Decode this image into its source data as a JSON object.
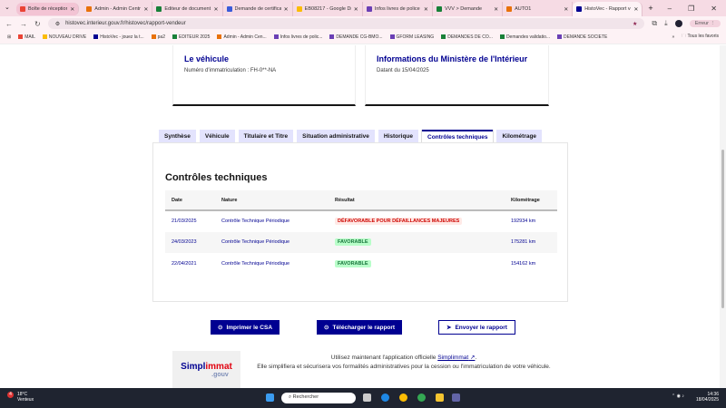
{
  "browser": {
    "tabs": [
      {
        "label": "Boîte de réception (2)",
        "color": "#ea4335"
      },
      {
        "label": "Admin - Admin Centr",
        "color": "#e8710a"
      },
      {
        "label": "Éditeur de document",
        "color": "#188038"
      },
      {
        "label": "Demande de certificat",
        "color": "#3a5bd9"
      },
      {
        "label": "EB08217 - Google Dr",
        "color": "#fbbc04"
      },
      {
        "label": "Infos livres de police",
        "color": "#6a3fb5"
      },
      {
        "label": "VVV > Demande",
        "color": "#188038"
      },
      {
        "label": "AUTO1",
        "color": "#e8710a"
      },
      {
        "label": "HistoVec - Rapport ve",
        "color": "#000091"
      }
    ],
    "url": "histovec.interieur.gouv.fr/histovec/rapport-vendeur",
    "profile_status": "Erreur",
    "bookmarks": [
      {
        "label": "MAIL",
        "color": "#ea4335"
      },
      {
        "label": "NOUVEAU DRIVE",
        "color": "#fbbc04"
      },
      {
        "label": "HistoVec - jouez la t...",
        "color": "#000091"
      },
      {
        "label": "pa2",
        "color": "#e8710a"
      },
      {
        "label": "EDITEUR 2025",
        "color": "#188038"
      },
      {
        "label": "Admin - Admin Cen...",
        "color": "#e8710a"
      },
      {
        "label": "Infos livres de polic...",
        "color": "#6a3fb5"
      },
      {
        "label": "DEMANDE CG-BMO...",
        "color": "#6a3fb5"
      },
      {
        "label": "GFORM LEASING",
        "color": "#6a3fb5"
      },
      {
        "label": "DEMANDES DE CO...",
        "color": "#188038"
      },
      {
        "label": "Demandes validatio...",
        "color": "#188038"
      },
      {
        "label": "DEMANDE SOCIETE",
        "color": "#6a3fb5"
      }
    ],
    "all_bookmarks": "Tous les favoris"
  },
  "cards": [
    {
      "title": "Le véhicule",
      "text": "Numéro d'immatriculation : FH-0**-NA"
    },
    {
      "title": "Informations du Ministère de l'Intérieur",
      "text": "Datant du 15/04/2025"
    }
  ],
  "tabs": [
    "Synthèse",
    "Véhicule",
    "Titulaire et Titre",
    "Situation administrative",
    "Historique",
    "Contrôles techniques",
    "Kilométrage"
  ],
  "active_tab": "Contrôles techniques",
  "section": {
    "title": "Contrôles techniques",
    "columns": [
      "Date",
      "Nature",
      "Résultat",
      "Kilométrage"
    ],
    "rows": [
      {
        "date": "21/03/2025",
        "nature": "Contrôle Technique Périodique",
        "result": "DÉFAVORABLE POUR DÉFAILLANCES MAJEURES",
        "status": "bad",
        "km": "192934 km"
      },
      {
        "date": "24/03/2023",
        "nature": "Contrôle Technique Périodique",
        "result": "FAVORABLE",
        "status": "good",
        "km": "175281 km"
      },
      {
        "date": "22/04/2021",
        "nature": "Contrôle Technique Périodique",
        "result": "FAVORABLE",
        "status": "good",
        "km": "154162 km"
      }
    ]
  },
  "actions": {
    "print": "Imprimer le CSA",
    "download": "Télécharger le rapport",
    "send": "Envoyer le rapport"
  },
  "promo": {
    "logo_main": "Simpl",
    "logo_accent": "immat",
    "logo_sub": ".gouv",
    "line1_pre": "Utilisez maintenant l'application officielle ",
    "link": "Simplimmat",
    "line1_post": ".",
    "line2": "Elle simplifiera et sécurisera vos formalités administratives pour la cession ou l'immatriculation de votre véhicule."
  },
  "taskbar": {
    "weather_temp": "18°C",
    "weather_text": "Venteux",
    "notif_count": "4",
    "search": "Rechercher",
    "time": "14:36",
    "date": "18/04/2025"
  }
}
